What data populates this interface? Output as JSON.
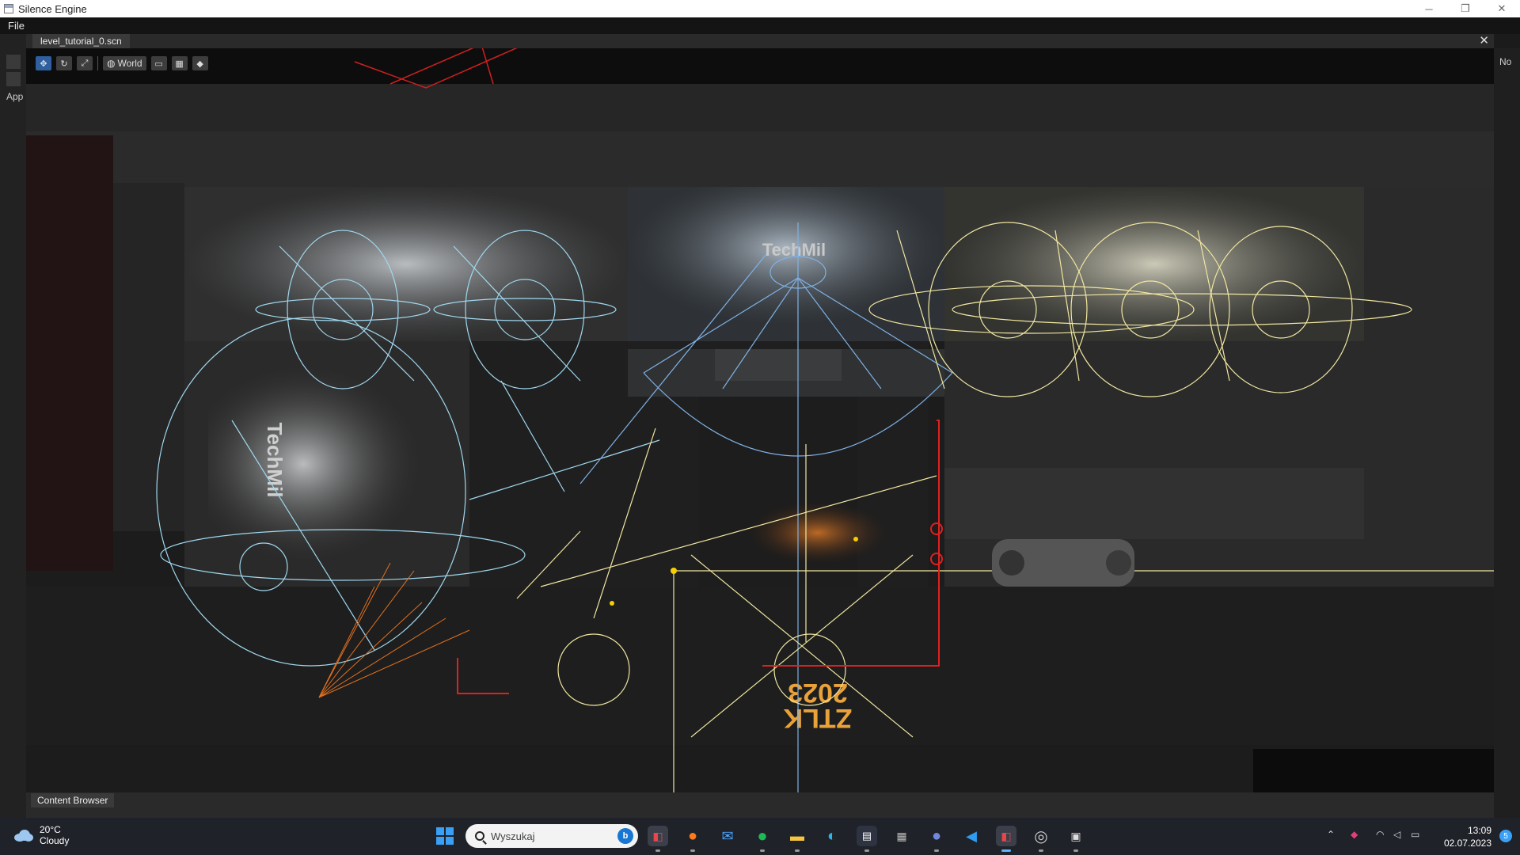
{
  "window": {
    "title": "Silence Engine",
    "minimize_icon": "─",
    "restore_icon": "❐",
    "close_icon": "✕"
  },
  "menu": {
    "items": [
      "File"
    ]
  },
  "left_panel": {
    "label": "App"
  },
  "right_panel": {
    "label": "No"
  },
  "editor_tab": {
    "filename": "level_tutorial_0.scn",
    "close_icon": "✕"
  },
  "toolbar": {
    "move_icon": "✥",
    "rotate_icon": "↻",
    "scale_icon": "⤢",
    "space_label": "World",
    "space_icon": "◍",
    "snap_icon": "▭",
    "grid_icon": "▦",
    "camera_icon": "◆"
  },
  "scene": {
    "sign_top": "TechMil",
    "sign_left": "TechMil",
    "floor_text_1": "2023",
    "floor_text_2": "ZTLK",
    "gizmo_colors": {
      "point_light": "#9fd8ef",
      "spot_light": "#f1e7a0",
      "selection": "#e02020",
      "particles": "#e07020"
    }
  },
  "bottom_panel": {
    "tab": "Content Browser"
  },
  "taskbar": {
    "weather_temp": "20°C",
    "weather_desc": "Cloudy",
    "search_placeholder": "Wyszukaj",
    "time": "13:09",
    "date": "02.07.2023",
    "notification_count": "5"
  }
}
